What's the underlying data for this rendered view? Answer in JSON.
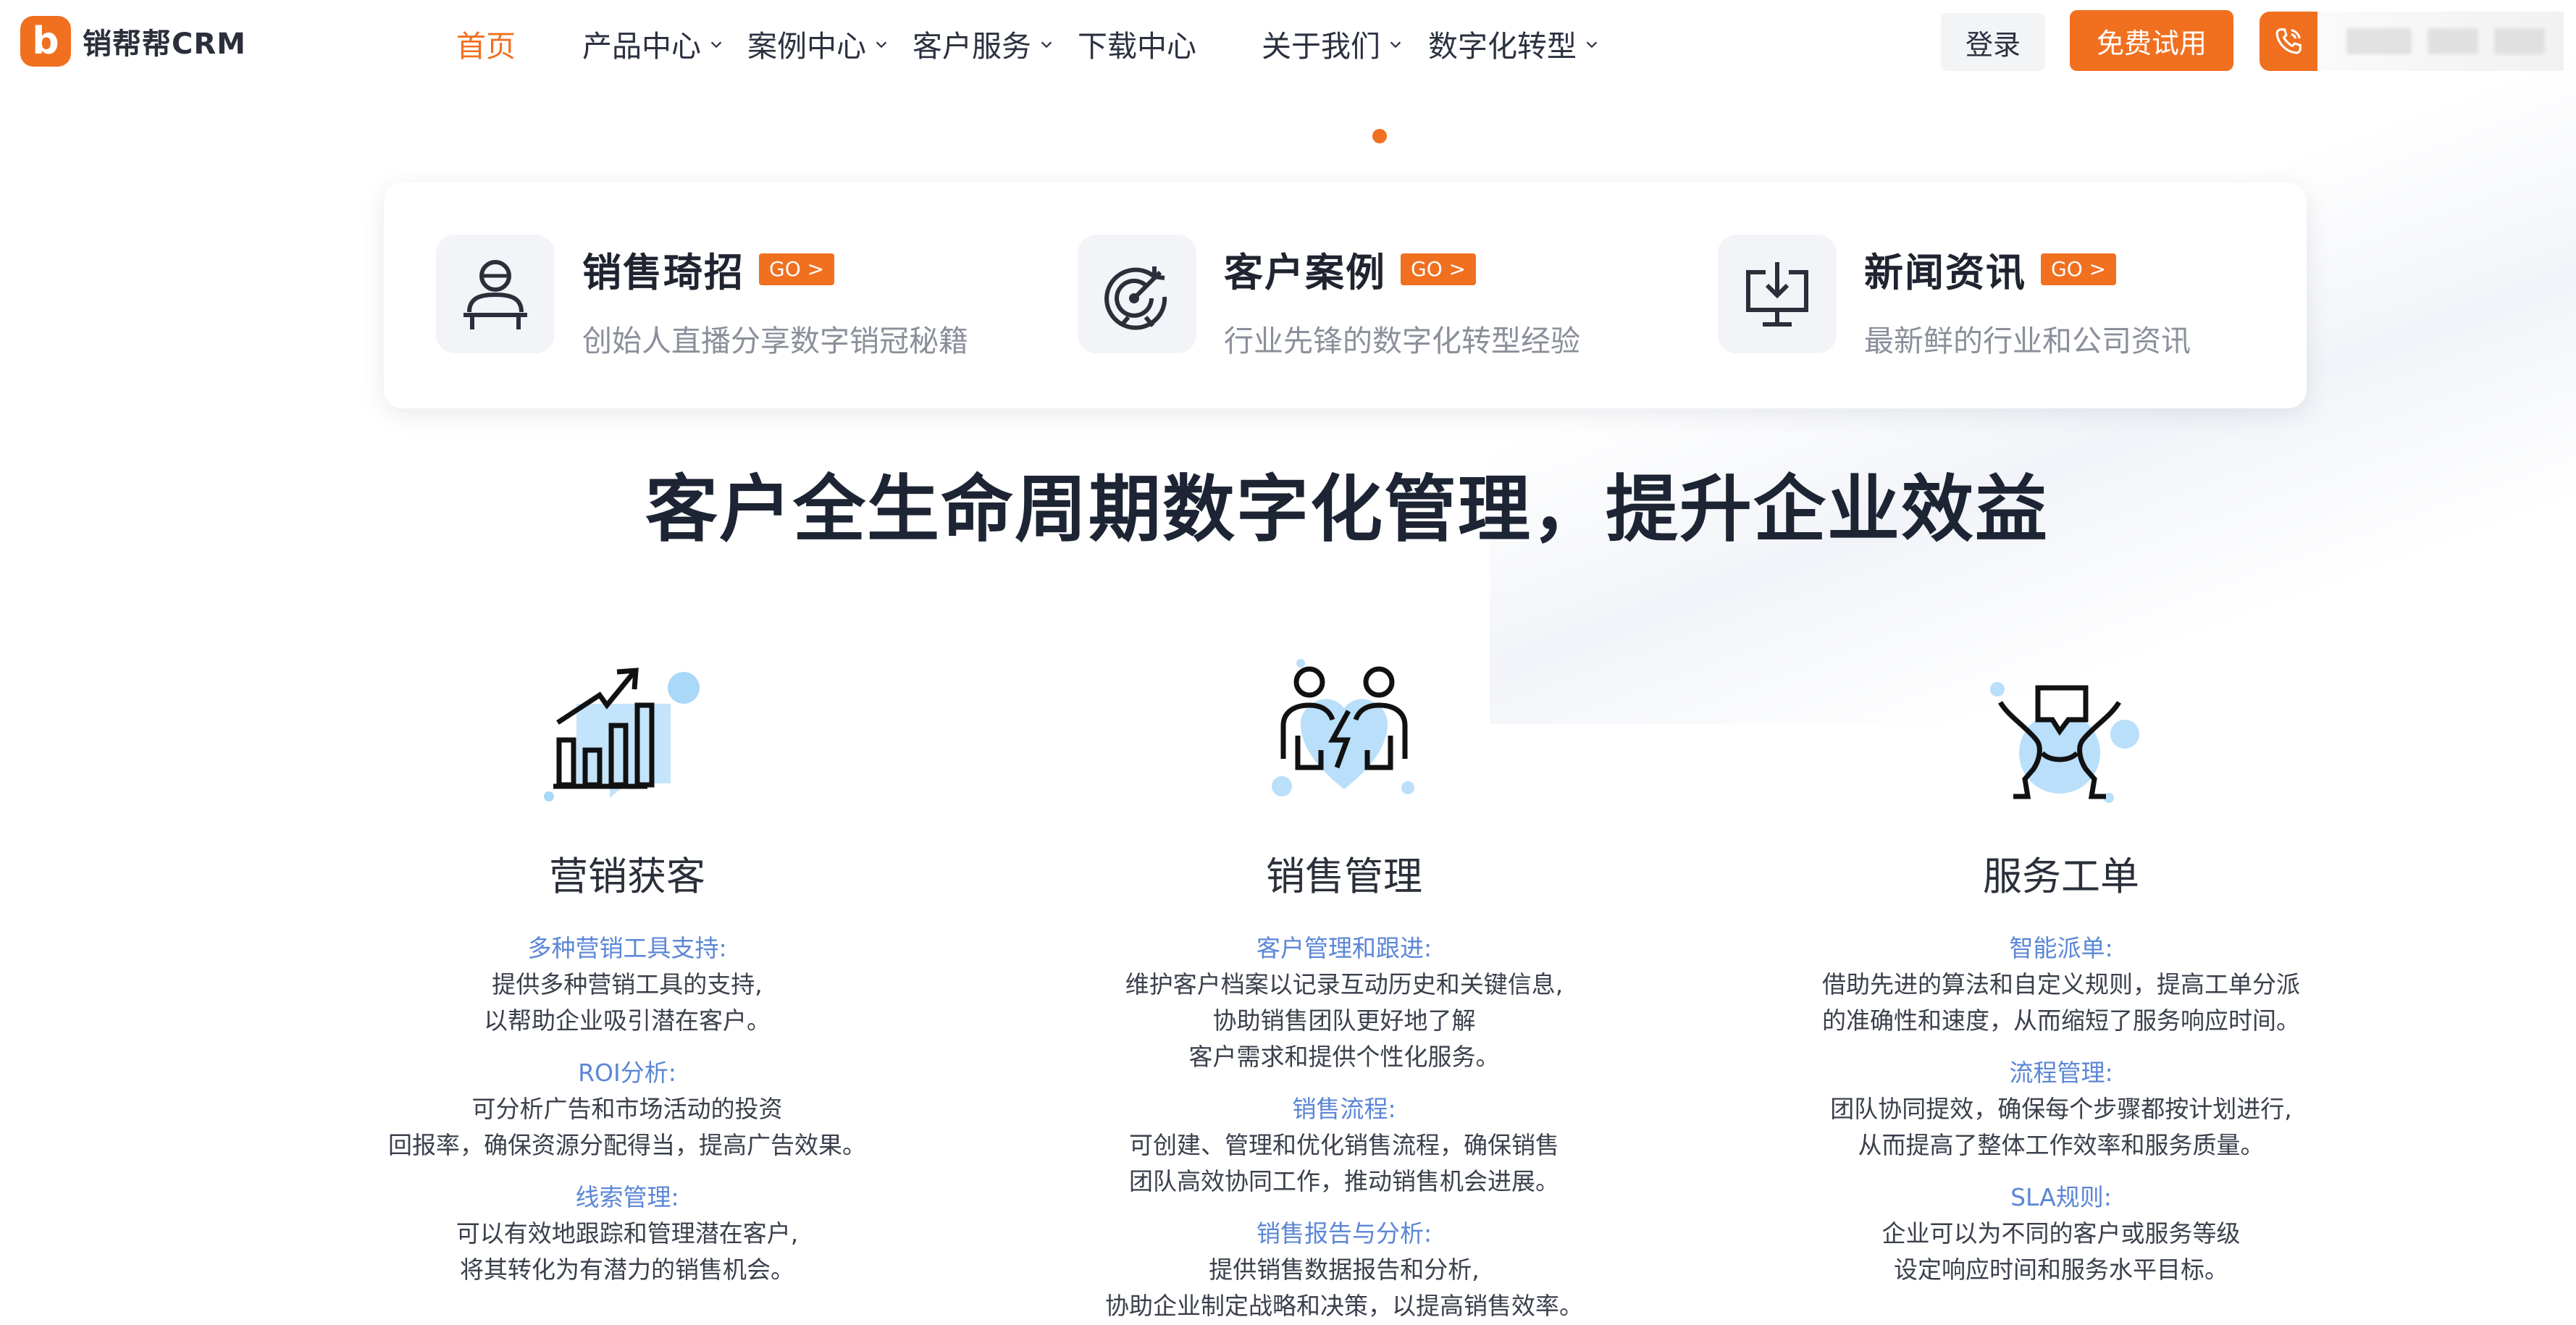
{
  "brand": {
    "logo_letter": "b",
    "name": "销帮帮CRM",
    "accent": "#f07020"
  },
  "nav": {
    "items": [
      {
        "label": "首页",
        "active": true,
        "dropdown": false
      },
      {
        "label": "产品中心",
        "active": false,
        "dropdown": true
      },
      {
        "label": "案例中心",
        "active": false,
        "dropdown": true
      },
      {
        "label": "客户服务",
        "active": false,
        "dropdown": true
      },
      {
        "label": "下载中心",
        "active": false,
        "dropdown": false
      },
      {
        "label": "关于我们",
        "active": false,
        "dropdown": true
      },
      {
        "label": "数字化转型",
        "active": false,
        "dropdown": true
      }
    ]
  },
  "header_actions": {
    "login_label": "登录",
    "trial_label": "免费试用",
    "phone_icon": "phone-icon"
  },
  "quick_links": [
    {
      "title": "销售琦招",
      "badge": "GO >",
      "desc": "创始人直播分享数字销冠秘籍",
      "icon": "presenter-icon"
    },
    {
      "title": "客户案例",
      "badge": "GO >",
      "desc": "行业先锋的数字化转型经验",
      "icon": "target-icon"
    },
    {
      "title": "新闻资讯",
      "badge": "GO >",
      "desc": "最新鲜的行业和公司资讯",
      "icon": "download-monitor-icon"
    }
  ],
  "headline": "客户全生命周期数字化管理，提升企业效益",
  "features": [
    {
      "title": "营销获客",
      "icon": "growth-chart-icon",
      "points": [
        {
          "title": "多种营销工具支持:",
          "lines": [
            "提供多种营销工具的支持,",
            "以帮助企业吸引潜在客户。"
          ]
        },
        {
          "title": "ROI分析:",
          "lines": [
            "可分析广告和市场活动的投资",
            "回报率，确保资源分配得当，提高广告效果。"
          ]
        },
        {
          "title": "线索管理:",
          "lines": [
            "可以有效地跟踪和管理潜在客户,",
            "将其转化为有潜力的销售机会。"
          ]
        }
      ]
    },
    {
      "title": "销售管理",
      "icon": "team-lightning-icon",
      "points": [
        {
          "title": "客户管理和跟进:",
          "lines": [
            "维护客户档案以记录互动历史和关键信息,",
            "协助销售团队更好地了解",
            "客户需求和提供个性化服务。"
          ]
        },
        {
          "title": "销售流程:",
          "lines": [
            "可创建、管理和优化销售流程，确保销售",
            "团队高效协同工作，推动销售机会进展。"
          ]
        },
        {
          "title": "销售报告与分析:",
          "lines": [
            "提供销售数据报告和分析,",
            "协助企业制定战略和决策，以提高销售效率。"
          ]
        }
      ]
    },
    {
      "title": "服务工单",
      "icon": "service-chat-icon",
      "points": [
        {
          "title": "智能派单:",
          "lines": [
            "借助先进的算法和自定义规则，提高工单分派",
            "的准确性和速度，从而缩短了服务响应时间。"
          ]
        },
        {
          "title": "流程管理:",
          "lines": [
            "团队协同提效，确保每个步骤都按计划进行,",
            "从而提高了整体工作效率和服务质量。"
          ]
        },
        {
          "title": "SLA规则:",
          "lines": [
            "企业可以为不同的客户或服务等级",
            "设定响应时间和服务水平目标。"
          ]
        }
      ]
    }
  ]
}
